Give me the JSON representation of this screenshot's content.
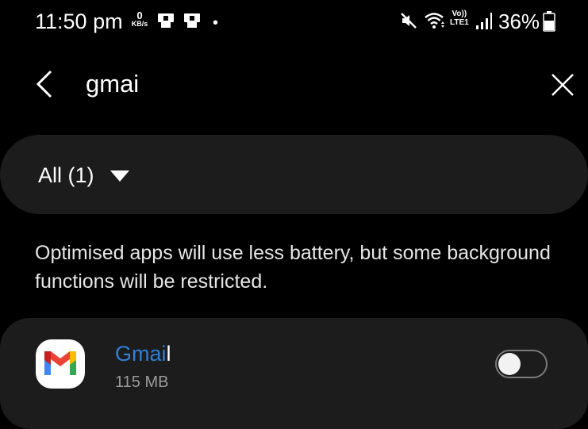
{
  "status_bar": {
    "time": "11:50 pm",
    "net_speed_value": "0",
    "net_speed_unit": "KB/s",
    "volte_top": "Vo))",
    "volte_bottom": "LTE1",
    "battery": "36%"
  },
  "search": {
    "query": "gmai"
  },
  "filter": {
    "label": "All (1)"
  },
  "info_text": "Optimised apps will use less battery, but some background functions will be restricted.",
  "app": {
    "name_match": "Gmai",
    "name_rest": "l",
    "size": "115 MB",
    "toggle_on": false
  },
  "colors": {
    "background": "#000000",
    "card": "#1c1c1c",
    "highlight": "#2f7fd6"
  }
}
